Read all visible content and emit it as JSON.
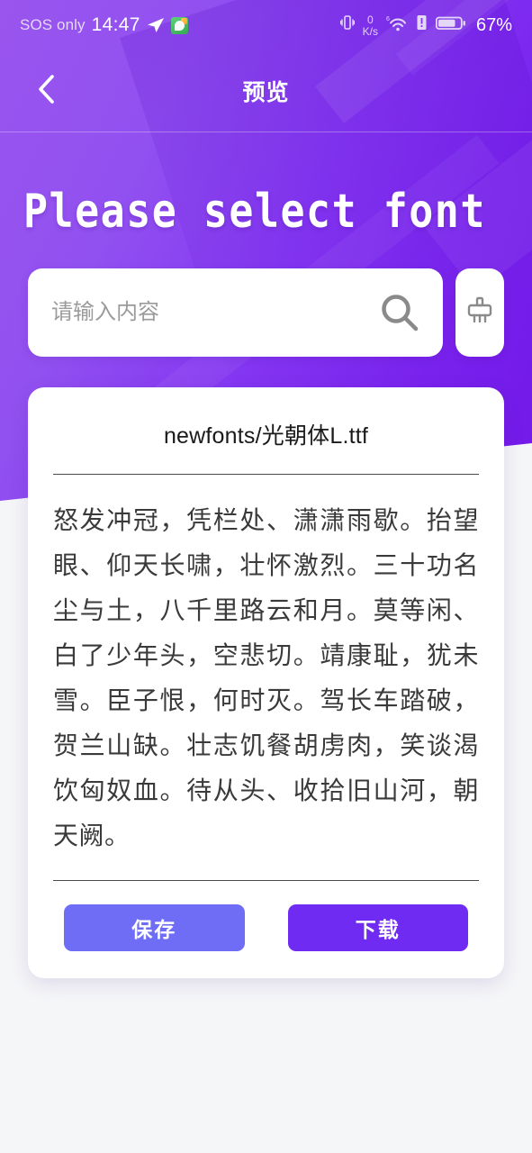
{
  "status_bar": {
    "carrier": "SOS only",
    "time": "14:47",
    "send_icon": "send-icon",
    "app_icon": "wechat-app-icon",
    "vibrate_icon": "vibrate-icon",
    "net_speed_value": "0",
    "net_speed_unit": "K/s",
    "wifi_icon": "wifi-6-icon",
    "sim_alert_icon": "sim-alert-icon",
    "battery_icon": "battery-icon",
    "battery_percent": "67%"
  },
  "navbar": {
    "back_icon": "back-chevron-icon",
    "title": "预览"
  },
  "hero": {
    "headline": "Please select font",
    "gradient_start": "#9A55EE",
    "gradient_end": "#7217E8"
  },
  "search": {
    "value": "",
    "placeholder": "请输入内容",
    "search_icon": "search-icon",
    "clear_icon": "broom-clear-icon"
  },
  "preview_card": {
    "font_name": "newfonts/光朝体L.ttf",
    "sample_text": "怒发冲冠，凭栏处、潇潇雨歇。抬望眼、仰天长啸，壮怀激烈。三十功名尘与土，八千里路云和月。莫等闲、白了少年头，空悲切。靖康耻，犹未雪。臣子恨，何时灭。驾长车踏破，贺兰山缺。壮志饥餐胡虏肉，笑谈渴饮匈奴血。待从头、收拾旧山河，朝天阙。",
    "save_label": "保存",
    "download_label": "下载",
    "save_color": "#6F6CF6",
    "download_color": "#6F2BF2"
  }
}
